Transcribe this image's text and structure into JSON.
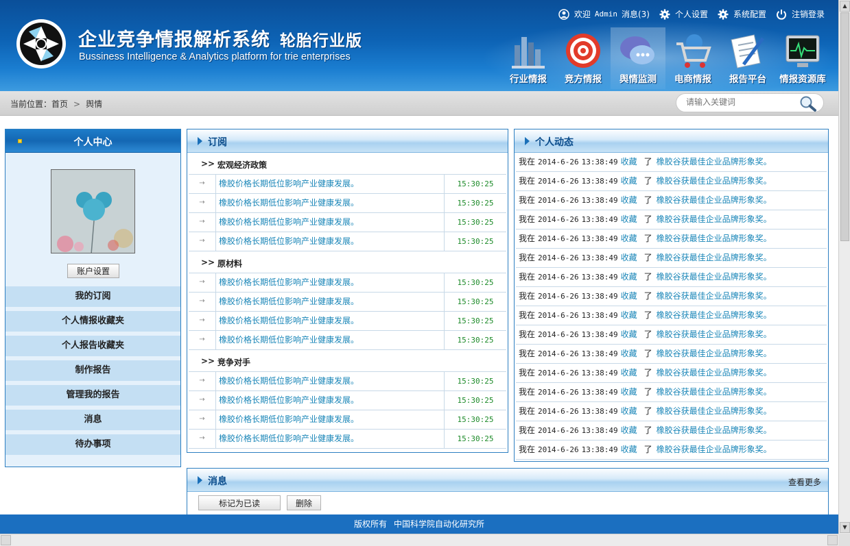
{
  "header": {
    "title_cn": "企业竞争情报解析系统",
    "edition": "轮胎行业版",
    "title_en": "Bussiness Intelligence & Analytics platform for trie enterprises",
    "welcome": "欢迎",
    "user": "Admin",
    "messages": "消息(3)",
    "settings": "个人设置",
    "sysconfig": "系统配置",
    "logout": "注销登录",
    "nav": [
      {
        "label": "行业情报",
        "icon": "bar-chart-icon"
      },
      {
        "label": "竞方情报",
        "icon": "target-icon"
      },
      {
        "label": "舆情监测",
        "icon": "chat-bubble-icon"
      },
      {
        "label": "电商情报",
        "icon": "shopping-cart-icon"
      },
      {
        "label": "报告平台",
        "icon": "document-pen-icon"
      },
      {
        "label": "情报资源库",
        "icon": "monitor-icon"
      }
    ],
    "active_nav": "舆情监测"
  },
  "breadcrumb": {
    "prefix": "当前位置：",
    "home": "首页",
    "sep": ">",
    "current": "舆情"
  },
  "search": {
    "placeholder": "请输入关键词"
  },
  "left": {
    "title": "个人中心",
    "account_btn": "账户设置",
    "menu": [
      "我的订阅",
      "个人情报收藏夹",
      "个人报告收藏夹",
      "制作报告",
      "管理我的报告",
      "消息",
      "待办事项"
    ]
  },
  "subscription": {
    "title": "订阅",
    "sections": [
      {
        "name": "宏观经济政策",
        "rows": [
          {
            "title": "橡胶价格长期低位影响产业健康发展。",
            "time": "15:30:25"
          },
          {
            "title": "橡胶价格长期低位影响产业健康发展。",
            "time": "15:30:25"
          },
          {
            "title": "橡胶价格长期低位影响产业健康发展。",
            "time": "15:30:25"
          },
          {
            "title": "橡胶价格长期低位影响产业健康发展。",
            "time": "15:30:25"
          }
        ]
      },
      {
        "name": "原材料",
        "rows": [
          {
            "title": "橡胶价格长期低位影响产业健康发展。",
            "time": "15:30:25"
          },
          {
            "title": "橡胶价格长期低位影响产业健康发展。",
            "time": "15:30:25"
          },
          {
            "title": "橡胶价格长期低位影响产业健康发展。",
            "time": "15:30:25"
          },
          {
            "title": "橡胶价格长期低位影响产业健康发展。",
            "time": "15:30:25"
          }
        ]
      },
      {
        "name": "竞争对手",
        "rows": [
          {
            "title": "橡胶价格长期低位影响产业健康发展。",
            "time": "15:30:25"
          },
          {
            "title": "橡胶价格长期低位影响产业健康发展。",
            "time": "15:30:25"
          },
          {
            "title": "橡胶价格长期低位影响产业健康发展。",
            "time": "15:30:25"
          },
          {
            "title": "橡胶价格长期低位影响产业健康发展。",
            "time": "15:30:25"
          }
        ]
      }
    ]
  },
  "activity": {
    "title": "个人动态",
    "rows": [
      {
        "who": "我在",
        "date": "2014-6-26",
        "time": "13:38:49",
        "action": "收藏",
        "le": "了",
        "link": "橡胶谷获最佳企业品牌形象奖。"
      },
      {
        "who": "我在",
        "date": "2014-6-26",
        "time": "13:38:49",
        "action": "收藏",
        "le": "了",
        "link": "橡胶谷获最佳企业品牌形象奖。"
      },
      {
        "who": "我在",
        "date": "2014-6-26",
        "time": "13:38:49",
        "action": "收藏",
        "le": "了",
        "link": "橡胶谷获最佳企业品牌形象奖。"
      },
      {
        "who": "我在",
        "date": "2014-6-26",
        "time": "13:38:49",
        "action": "收藏",
        "le": "了",
        "link": "橡胶谷获最佳企业品牌形象奖。"
      },
      {
        "who": "我在",
        "date": "2014-6-26",
        "time": "13:38:49",
        "action": "收藏",
        "le": "了",
        "link": "橡胶谷获最佳企业品牌形象奖。"
      },
      {
        "who": "我在",
        "date": "2014-6-26",
        "time": "13:38:49",
        "action": "收藏",
        "le": "了",
        "link": "橡胶谷获最佳企业品牌形象奖。"
      },
      {
        "who": "我在",
        "date": "2014-6-26",
        "time": "13:38:49",
        "action": "收藏",
        "le": "了",
        "link": "橡胶谷获最佳企业品牌形象奖。"
      },
      {
        "who": "我在",
        "date": "2014-6-26",
        "time": "13:38:49",
        "action": "收藏",
        "le": "了",
        "link": "橡胶谷获最佳企业品牌形象奖。"
      },
      {
        "who": "我在",
        "date": "2014-6-26",
        "time": "13:38:49",
        "action": "收藏",
        "le": "了",
        "link": "橡胶谷获最佳企业品牌形象奖。"
      },
      {
        "who": "我在",
        "date": "2014-6-26",
        "time": "13:38:49",
        "action": "收藏",
        "le": "了",
        "link": "橡胶谷获最佳企业品牌形象奖。"
      },
      {
        "who": "我在",
        "date": "2014-6-26",
        "time": "13:38:49",
        "action": "收藏",
        "le": "了",
        "link": "橡胶谷获最佳企业品牌形象奖。"
      },
      {
        "who": "我在",
        "date": "2014-6-26",
        "time": "13:38:49",
        "action": "收藏",
        "le": "了",
        "link": "橡胶谷获最佳企业品牌形象奖。"
      },
      {
        "who": "我在",
        "date": "2014-6-26",
        "time": "13:38:49",
        "action": "收藏",
        "le": "了",
        "link": "橡胶谷获最佳企业品牌形象奖。"
      },
      {
        "who": "我在",
        "date": "2014-6-26",
        "time": "13:38:49",
        "action": "收藏",
        "le": "了",
        "link": "橡胶谷获最佳企业品牌形象奖。"
      },
      {
        "who": "我在",
        "date": "2014-6-26",
        "time": "13:38:49",
        "action": "收藏",
        "le": "了",
        "link": "橡胶谷获最佳企业品牌形象奖。"
      },
      {
        "who": "我在",
        "date": "2014-6-26",
        "time": "13:38:49",
        "action": "收藏",
        "le": "了",
        "link": "橡胶谷获最佳企业品牌形象奖。"
      }
    ]
  },
  "messages": {
    "title": "消息",
    "more": "查看更多",
    "mark_read": "标记为已读",
    "delete": "删除"
  },
  "footer": {
    "copyright": "版权所有",
    "org": "中国科学院自动化研究所"
  },
  "colors": {
    "header_blue": "#0d63b5",
    "link": "#1a86b8",
    "time_green": "#1c8a28",
    "footer": "#1b6fc0",
    "menu_bg": "#c4dff3"
  }
}
